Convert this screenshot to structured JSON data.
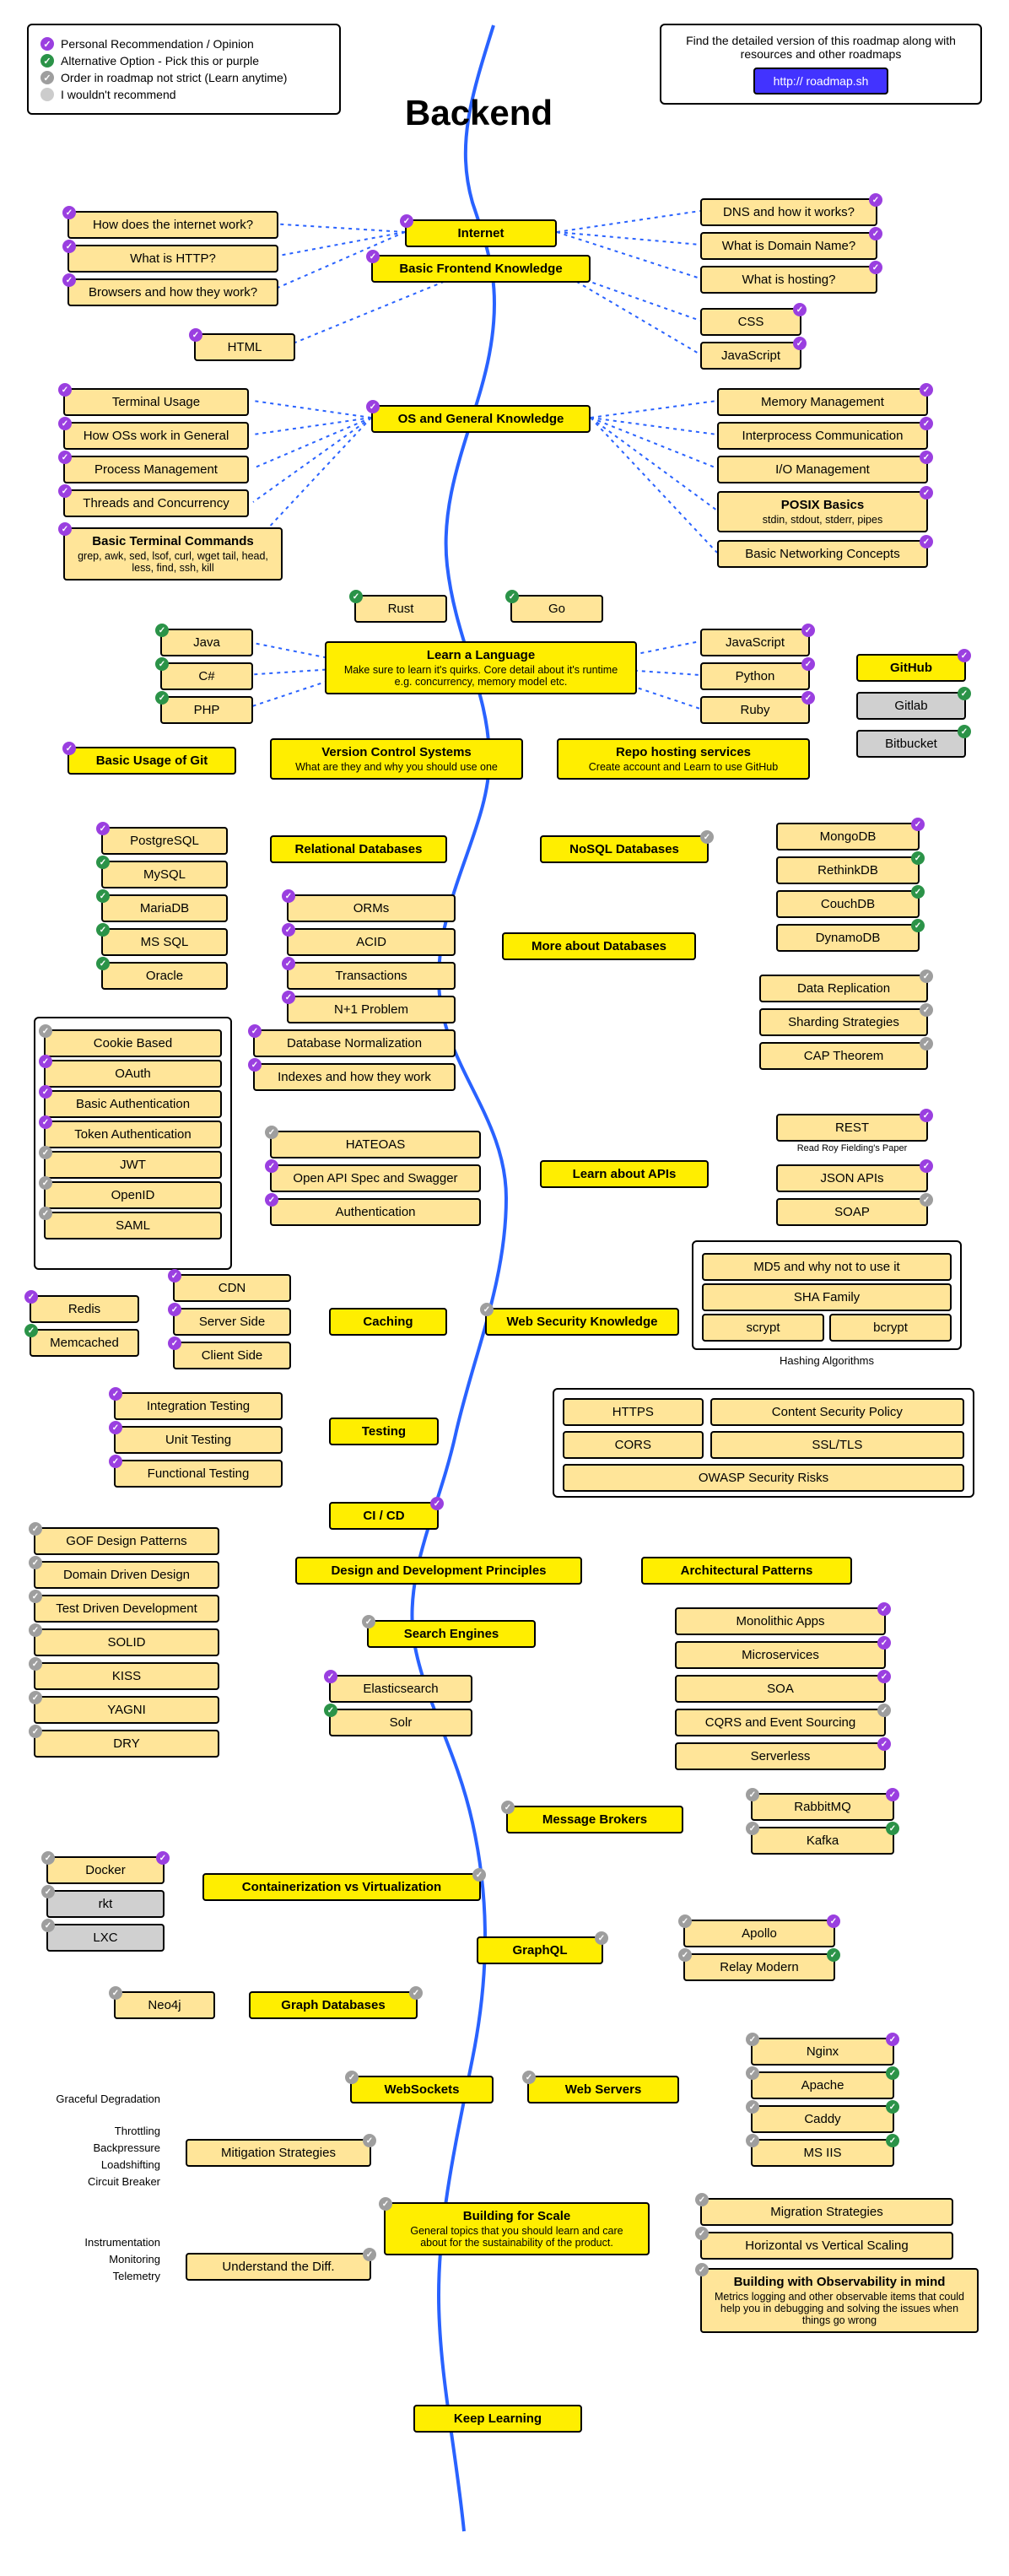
{
  "title": "Backend",
  "legend": {
    "purple": "Personal Recommendation / Opinion",
    "green": "Alternative Option - Pick this or purple",
    "gray": "Order in roadmap not strict (Learn anytime)",
    "graylt": "I wouldn't recommend"
  },
  "info": {
    "text": "Find the detailed version of this roadmap along with resources and other roadmaps",
    "link": "http:// roadmap.sh"
  },
  "nodes": {
    "internet": "Internet",
    "bfk": "Basic Frontend Knowledge",
    "howInternet": "How does the internet work?",
    "whatHttp": "What is HTTP?",
    "browsers": "Browsers and how they work?",
    "html": "HTML",
    "dns": "DNS and how it works?",
    "domainName": "What is Domain Name?",
    "hosting": "What is hosting?",
    "css": "CSS",
    "js": "JavaScript",
    "osgk": "OS and General Knowledge",
    "termUsage": "Terminal Usage",
    "osGeneral": "How OSs work in General",
    "procMgmt": "Process Management",
    "threads": "Threads and Concurrency",
    "btc": "Basic Terminal Commands",
    "btcSub": "grep, awk, sed, lsof, curl, wget tail, head, less, find, ssh, kill",
    "memMgmt": "Memory Management",
    "ipc": "Interprocess Communication",
    "ioMgmt": "I/O Management",
    "posix": "POSIX Basics",
    "posixSub": "stdin, stdout, stderr, pipes",
    "netConcepts": "Basic Networking Concepts",
    "rust": "Rust",
    "go": "Go",
    "learnLang": "Learn a Language",
    "learnLangSub": "Make sure to learn it's quirks. Core detail about it's runtime e.g. concurrency, memory model etc.",
    "java": "Java",
    "csharp": "C#",
    "php": "PHP",
    "jsLang": "JavaScript",
    "python": "Python",
    "ruby": "Ruby",
    "github": "GitHub",
    "gitlab": "Gitlab",
    "bitbucket": "Bitbucket",
    "gitBasic": "Basic Usage of Git",
    "vcs": "Version Control Systems",
    "vcsSub": "What are they and why you should use one",
    "repoHost": "Repo hosting services",
    "repoHostSub": "Create account and Learn to use GitHub",
    "relDb": "Relational Databases",
    "noSql": "NoSQL Databases",
    "postgres": "PostgreSQL",
    "mysql": "MySQL",
    "mariadb": "MariaDB",
    "mssql": "MS SQL",
    "oracle": "Oracle",
    "mongo": "MongoDB",
    "rethink": "RethinkDB",
    "couch": "CouchDB",
    "dynamo": "DynamoDB",
    "moreDb": "More about Databases",
    "orms": "ORMs",
    "acid": "ACID",
    "txn": "Transactions",
    "n1": "N+1 Problem",
    "dbNorm": "Database Normalization",
    "indexes": "Indexes and how they work",
    "dataRepl": "Data Replication",
    "sharding": "Sharding Strategies",
    "cap": "CAP Theorem",
    "cookie": "Cookie Based",
    "oauth": "OAuth",
    "basicAuth": "Basic Authentication",
    "tokenAuth": "Token Authentication",
    "jwt": "JWT",
    "openid": "OpenID",
    "saml": "SAML",
    "hateoas": "HATEOAS",
    "openapi": "Open API Spec and Swagger",
    "auth": "Authentication",
    "learnApis": "Learn about APIs",
    "rest": "REST",
    "restSub": "Read Roy Fielding's Paper",
    "jsonApis": "JSON APIs",
    "soap": "SOAP",
    "md5": "MD5 and why not to use it",
    "sha": "SHA Family",
    "scrypt": "scrypt",
    "bcrypt": "bcrypt",
    "hashAlg": "Hashing Algorithms",
    "caching": "Caching",
    "cdn": "CDN",
    "serverSide": "Server Side",
    "clientSide": "Client Side",
    "redis": "Redis",
    "memcached": "Memcached",
    "webSec": "Web Security Knowledge",
    "https": "HTTPS",
    "cors": "CORS",
    "csp": "Content Security Policy",
    "ssl": "SSL/TLS",
    "owasp": "OWASP Security Risks",
    "testing": "Testing",
    "intTest": "Integration Testing",
    "unitTest": "Unit Testing",
    "funcTest": "Functional Testing",
    "cicd": "CI / CD",
    "ddp": "Design and Development Principles",
    "archPat": "Architectural Patterns",
    "gof": "GOF Design Patterns",
    "ddd": "Domain Driven Design",
    "tdd": "Test Driven Development",
    "solid": "SOLID",
    "kiss": "KISS",
    "yagni": "YAGNI",
    "dry": "DRY",
    "mono": "Monolithic Apps",
    "micro": "Microservices",
    "soa": "SOA",
    "cqrs": "CQRS and Event Sourcing",
    "serverless": "Serverless",
    "searchEng": "Search Engines",
    "elastic": "Elasticsearch",
    "solr": "Solr",
    "msgBrokers": "Message Brokers",
    "rabbit": "RabbitMQ",
    "kafka": "Kafka",
    "docker": "Docker",
    "rkt": "rkt",
    "lxc": "LXC",
    "contVirt": "Containerization vs Virtualization",
    "graphql": "GraphQL",
    "apollo": "Apollo",
    "relay": "Relay Modern",
    "graphDb": "Graph Databases",
    "neo4j": "Neo4j",
    "websockets": "WebSockets",
    "webServers": "Web Servers",
    "nginx": "Nginx",
    "apache": "Apache",
    "caddy": "Caddy",
    "msiis": "MS IIS",
    "mitigation": "Mitigation Strategies",
    "understand": "Understand the Diff.",
    "bfs": "Building for Scale",
    "bfsSub": "General topics that you should learn and care about for the sustainability of the product.",
    "migration": "Migration Strategies",
    "hvScale": "Horizontal vs Vertical Scaling",
    "obsv": "Building with Observability in mind",
    "obsvSub": "Metrics logging and other observable items that could help you in debugging and solving the issues when things go wrong",
    "keepLearning": "Keep Learning",
    "sideLabels": {
      "l1": "Graceful Degradation",
      "l2": "Throttling",
      "l3": "Backpressure",
      "l4": "Loadshifting",
      "l5": "Circuit Breaker",
      "l6": "Instrumentation",
      "l7": "Monitoring",
      "l8": "Telemetry"
    }
  }
}
